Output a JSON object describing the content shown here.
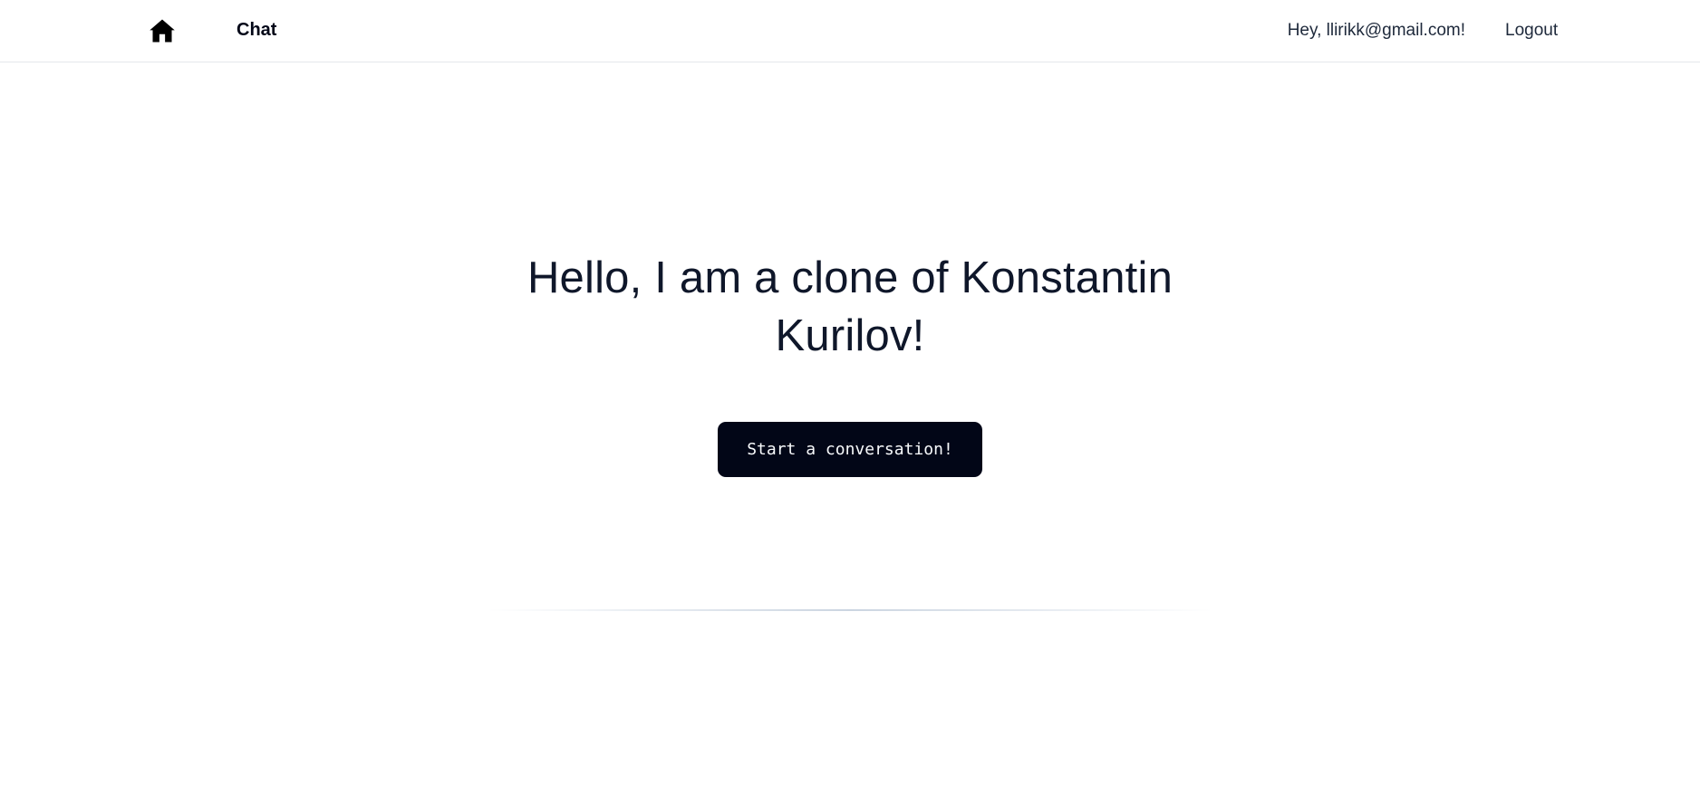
{
  "navbar": {
    "home_icon": "home-icon",
    "chat_label": "Chat",
    "greeting": "Hey, llirikk@gmail.com!",
    "logout_label": "Logout"
  },
  "hero": {
    "title": "Hello, I am a clone of Konstantin Kurilov!",
    "cta_label": "Start a conversation!"
  },
  "colors": {
    "button_bg": "#020617",
    "button_text": "#f8fafc",
    "text_primary": "#0f172a"
  }
}
